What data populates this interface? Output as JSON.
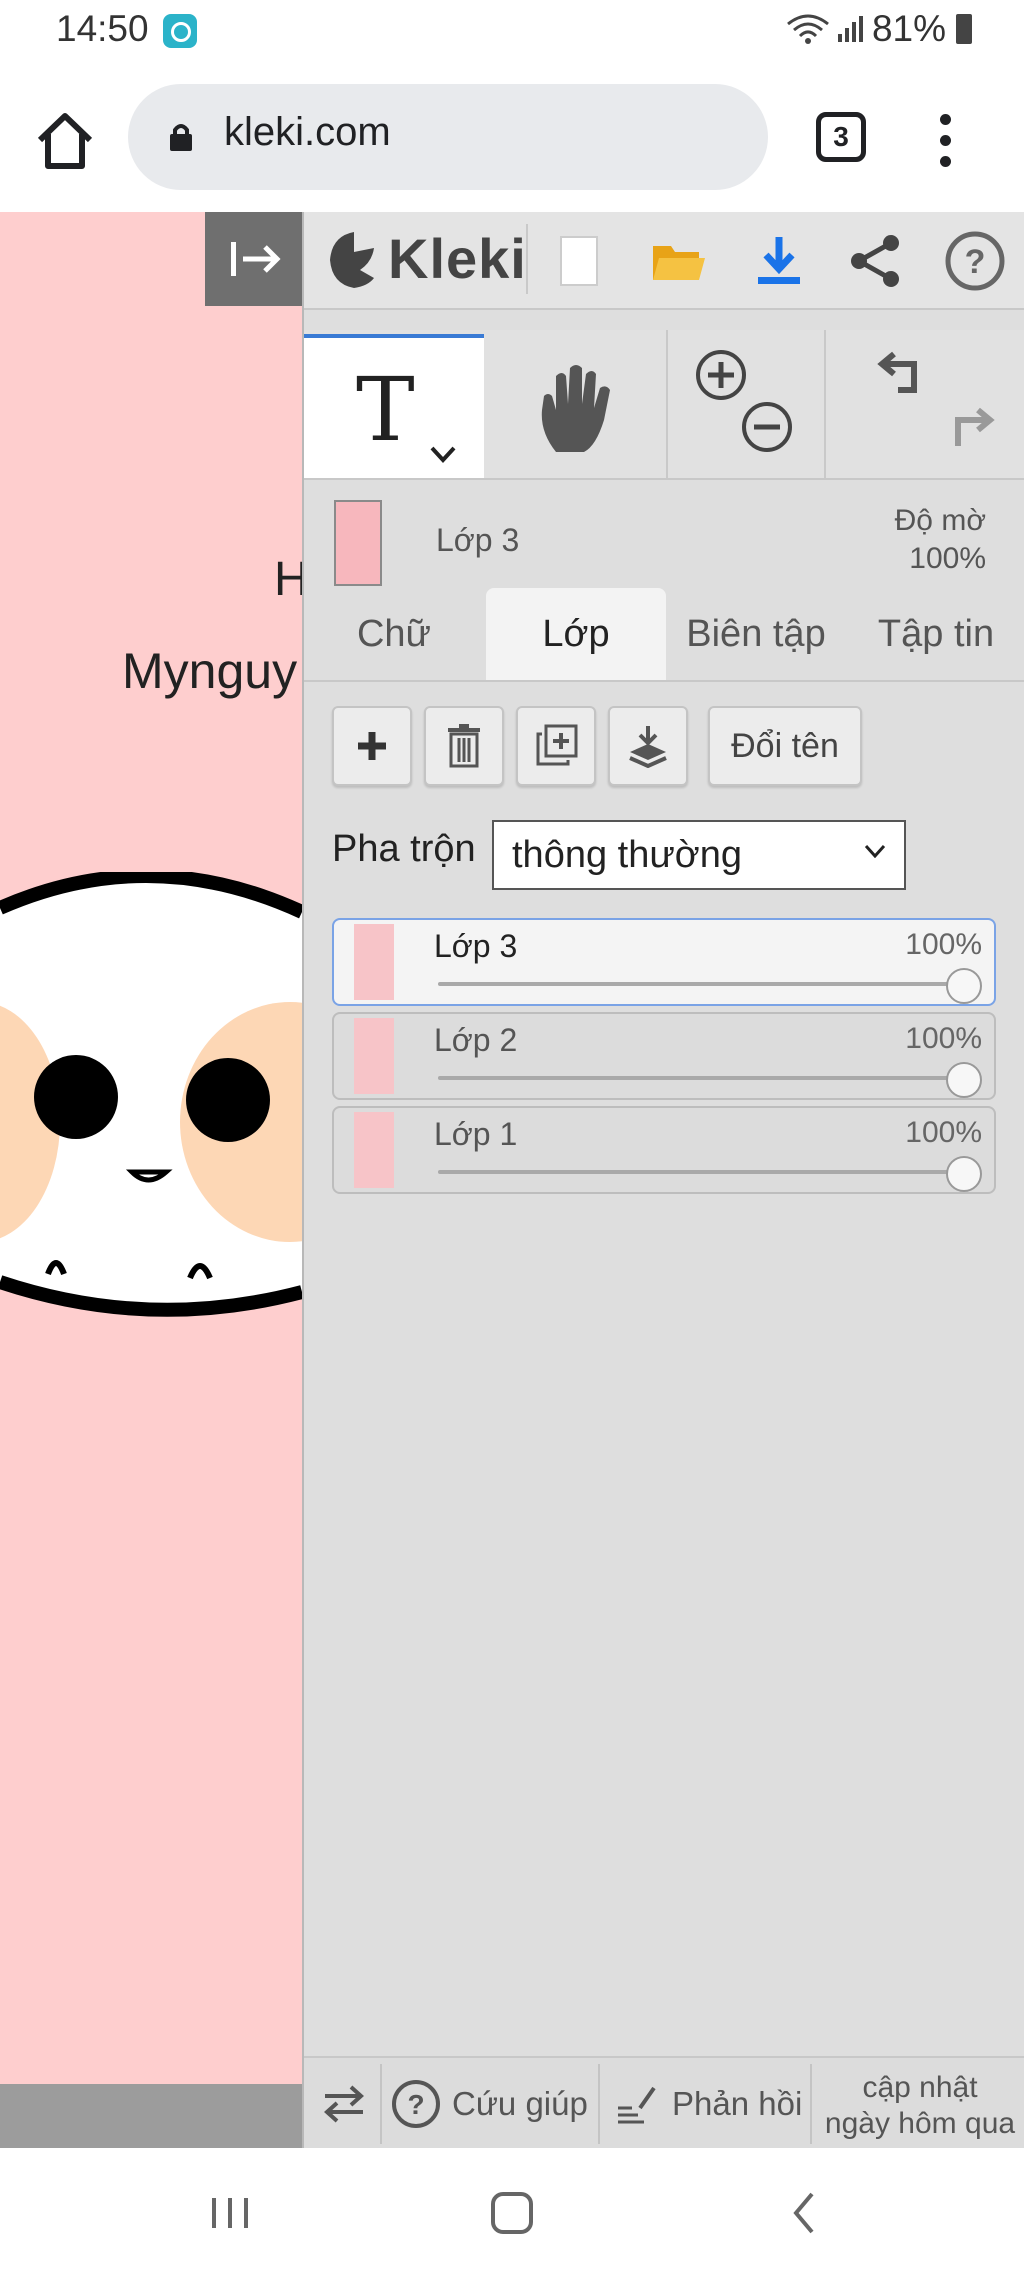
{
  "status_bar": {
    "time": "14:50",
    "battery": "81%"
  },
  "browser": {
    "url": "kleki.com",
    "tab_count": "3"
  },
  "canvas": {
    "text_line1": "H",
    "text_line2": "Mynguy"
  },
  "app": {
    "name": "Kleki"
  },
  "current_layer": {
    "name": "Lớp 3",
    "opacity_label": "Độ mờ",
    "opacity_value": "100%"
  },
  "tabs": [
    {
      "label": "Chữ",
      "active": false
    },
    {
      "label": "Lớp",
      "active": true
    },
    {
      "label": "Biên tập",
      "active": false
    },
    {
      "label": "Tập tin",
      "active": false
    }
  ],
  "layer_actions": {
    "rename": "Đổi tên"
  },
  "blend": {
    "label": "Pha trộn",
    "value": "thông thường"
  },
  "layers": [
    {
      "name": "Lớp 3",
      "opacity": "100%",
      "opacity_fraction": 1.0,
      "active": true
    },
    {
      "name": "Lớp 2",
      "opacity": "100%",
      "opacity_fraction": 1.0,
      "active": false
    },
    {
      "name": "Lớp 1",
      "opacity": "100%",
      "opacity_fraction": 1.0,
      "active": false
    }
  ],
  "footer": {
    "help": "Cứu giúp",
    "feedback": "Phản hồi",
    "update_line1": "cập nhật",
    "update_line2": "ngày hôm qua"
  },
  "colors": {
    "accent": "#3a7bd5",
    "canvas_bg": "#fecece",
    "panel_bg": "#dedede"
  }
}
